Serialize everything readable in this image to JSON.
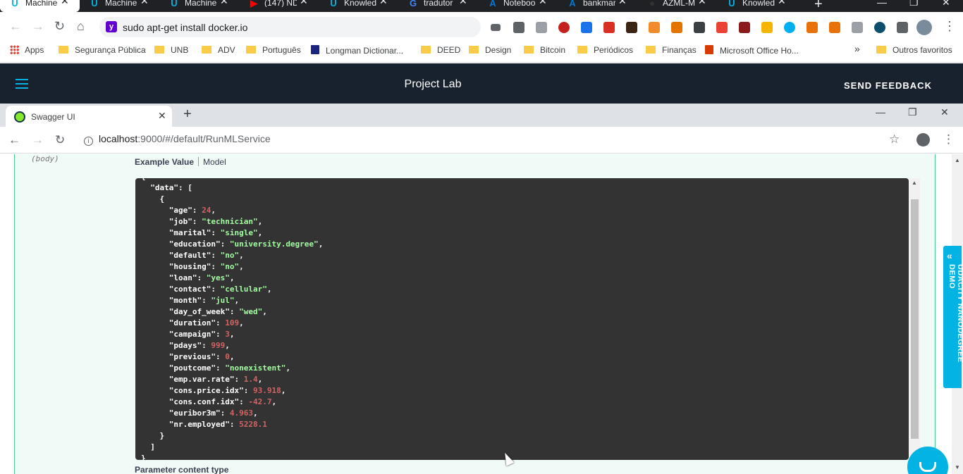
{
  "outer_browser": {
    "tabs": [
      {
        "title": "Machine",
        "icon": "udacity-icon",
        "active": true
      },
      {
        "title": "Machine",
        "icon": "udacity-icon"
      },
      {
        "title": "Machine",
        "icon": "udacity-icon"
      },
      {
        "title": "(147) ND",
        "icon": "youtube-icon"
      },
      {
        "title": "Knowledg",
        "icon": "udacity-icon"
      },
      {
        "title": "tradutor",
        "icon": "google-icon"
      },
      {
        "title": "Notebook",
        "icon": "azure-ml-icon"
      },
      {
        "title": "bankmar",
        "icon": "azure-ml-icon"
      },
      {
        "title": "AZML-M",
        "icon": "github-icon"
      },
      {
        "title": "Knowledg",
        "icon": "udacity-icon"
      }
    ],
    "address": "sudo apt-get install docker.io",
    "bookmarks": [
      {
        "label": "Apps",
        "icon": "apps-icon"
      },
      {
        "label": "Segurança Pública",
        "icon": "folder-icon"
      },
      {
        "label": "UNB",
        "icon": "folder-icon"
      },
      {
        "label": "ADV",
        "icon": "folder-icon"
      },
      {
        "label": "Português",
        "icon": "folder-icon"
      },
      {
        "label": "Longman Dictionar...",
        "icon": "longman-icon"
      },
      {
        "label": "DEED",
        "icon": "folder-icon"
      },
      {
        "label": "Design",
        "icon": "folder-icon"
      },
      {
        "label": "Bitcoin",
        "icon": "folder-icon"
      },
      {
        "label": "Periódicos",
        "icon": "folder-icon"
      },
      {
        "label": "Finanças",
        "icon": "folder-icon"
      },
      {
        "label": "Microsoft Office Ho...",
        "icon": "office-icon"
      }
    ],
    "bookmarks_overflow": "»",
    "other_bookmarks": "Outros favoritos"
  },
  "lab": {
    "title": "Project Lab",
    "feedback": "SEND FEEDBACK",
    "side_tab": "UDACITY NANODEGREE DEMO"
  },
  "inner_browser": {
    "tab_title": "Swagger UI",
    "url_host": "localhost",
    "url_path": ":9000/#/default/RunMLService"
  },
  "swagger": {
    "param_in": "(body)",
    "tab_example": "Example Value",
    "tab_model": "Model",
    "content_type_label": "Parameter content type",
    "example_fields": [
      {
        "key": "age",
        "value": "24",
        "type": "number"
      },
      {
        "key": "job",
        "value": "\"technician\"",
        "type": "string"
      },
      {
        "key": "marital",
        "value": "\"single\"",
        "type": "string"
      },
      {
        "key": "education",
        "value": "\"university.degree\"",
        "type": "string"
      },
      {
        "key": "default",
        "value": "\"no\"",
        "type": "string"
      },
      {
        "key": "housing",
        "value": "\"no\"",
        "type": "string"
      },
      {
        "key": "loan",
        "value": "\"yes\"",
        "type": "string"
      },
      {
        "key": "contact",
        "value": "\"cellular\"",
        "type": "string"
      },
      {
        "key": "month",
        "value": "\"jul\"",
        "type": "string"
      },
      {
        "key": "day_of_week",
        "value": "\"wed\"",
        "type": "string"
      },
      {
        "key": "duration",
        "value": "109",
        "type": "number"
      },
      {
        "key": "campaign",
        "value": "3",
        "type": "number"
      },
      {
        "key": "pdays",
        "value": "999",
        "type": "number"
      },
      {
        "key": "previous",
        "value": "0",
        "type": "number"
      },
      {
        "key": "poutcome",
        "value": "\"nonexistent\"",
        "type": "string"
      },
      {
        "key": "emp.var.rate",
        "value": "1.4",
        "type": "number"
      },
      {
        "key": "cons.price.idx",
        "value": "93.918",
        "type": "number"
      },
      {
        "key": "cons.conf.idx",
        "value": "-42.7",
        "type": "number"
      },
      {
        "key": "euribor3m",
        "value": "4.963",
        "type": "number"
      },
      {
        "key": "nr.employed",
        "value": "5228.1",
        "type": "number"
      }
    ]
  },
  "colors": {
    "udacity_blue": "#02b3e4",
    "lab_header": "#17222e",
    "swagger_post_green": "#49cc90",
    "code_bg": "#333333",
    "json_string": "#a2fca2",
    "json_number": "#d36363"
  }
}
